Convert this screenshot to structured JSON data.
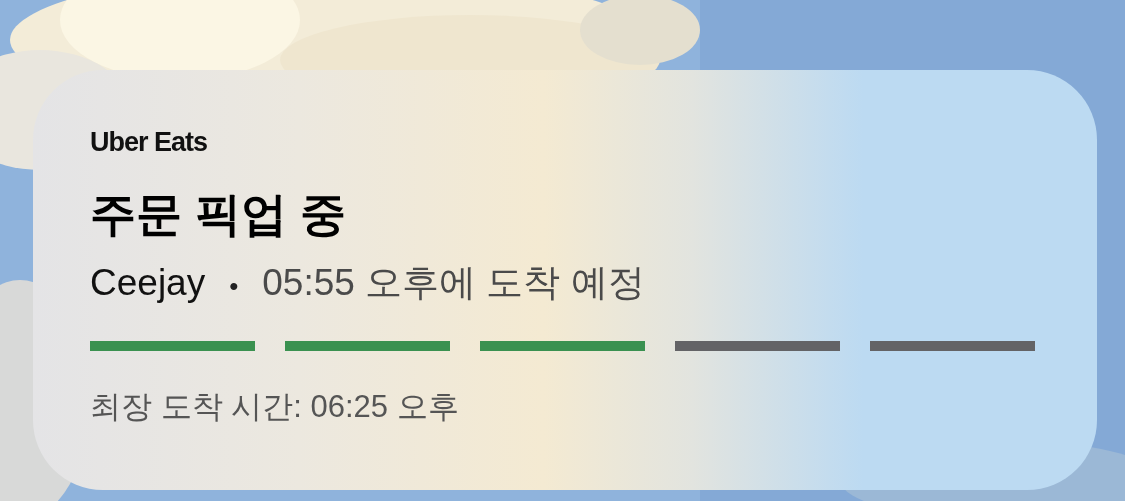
{
  "activity": {
    "brand": "Uber Eats",
    "title": "주문 픽업 중",
    "driver": "Ceejay",
    "separator": "•",
    "eta": "05:55 오후에 도착 예정",
    "steps": [
      {
        "done": true
      },
      {
        "done": true
      },
      {
        "done": true
      },
      {
        "done": false
      },
      {
        "done": false
      }
    ],
    "latest_arrival": "최장 도착 시간: 06:25 오후"
  }
}
